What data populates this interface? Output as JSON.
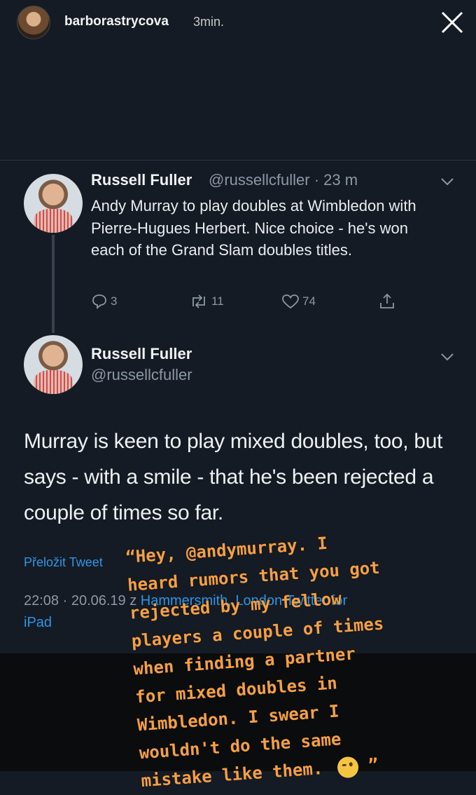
{
  "story": {
    "username": "barborastrycova",
    "time": "3min."
  },
  "tweet1": {
    "name": "Russell Fuller",
    "handle": "@russellcfuller · 23 m",
    "text": "Andy Murray to play doubles at Wimbledon with Pierre-Hugues Herbert. Nice choice - he's won each of the Grand Slam doubles titles.",
    "replies": "3",
    "retweets": "11",
    "likes": "74"
  },
  "tweet2": {
    "name": "Russell Fuller",
    "handle": "@russellcfuller",
    "text": "Murray is keen to play mixed doubles, too, but says - with a smile - that he's been rejected a couple of times so far.",
    "translate": "Přeložit Tweet",
    "meta_time": "22:08 · 20.06.19 z",
    "meta_place": "Hammersmith, London",
    "meta_source": "Twitter for",
    "meta_source2": "iPad"
  },
  "overlay_lines": [
    "“Hey, @andymurray. I",
    "heard rumors that you got",
    "rejected by my fellow",
    "players a couple of times",
    "when finding a partner",
    "for mixed doubles in",
    "Wimbledon. I swear I",
    "wouldn't do the same",
    "mistake like them."
  ],
  "overlay_end": "”",
  "icons": [
    "close-icon",
    "chevron-down-icon",
    "reply-icon",
    "retweet-icon",
    "like-icon",
    "share-icon",
    "wink-emoji-icon"
  ]
}
